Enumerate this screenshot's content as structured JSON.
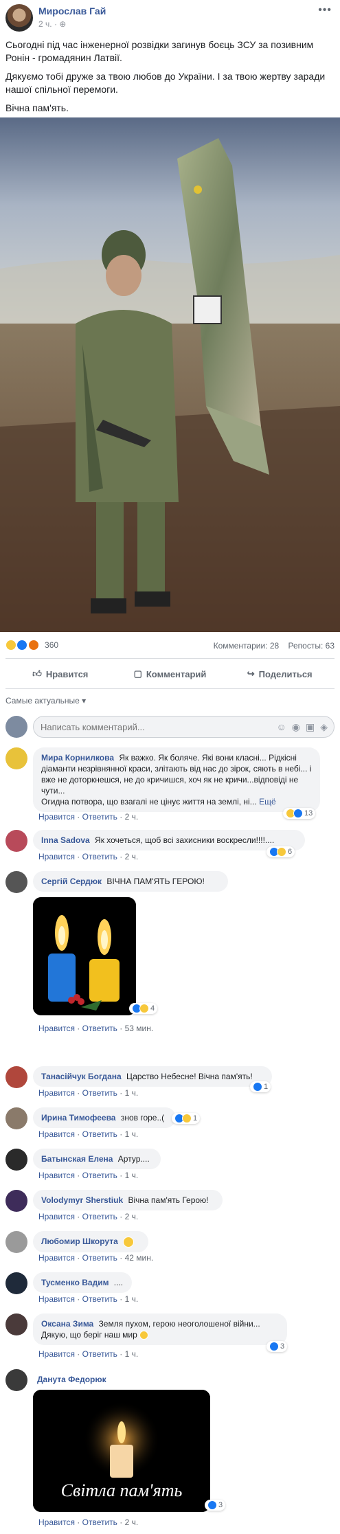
{
  "post": {
    "author": "Мирослав Гай",
    "time": "2 ч.",
    "paragraphs": [
      "Сьогодні під час інженерної розвідки загинув боєць ЗСУ за позивним Ронін - громадянин Латвії.",
      "Дякуємо тобі друже за твою любов до України. І за твою жертву заради нашої спільної перемоги.",
      "Вічна пам'ять."
    ],
    "reaction_count": "360",
    "comments_label": "Комментарии: 28",
    "shares_label": "Репосты: 63"
  },
  "actions": {
    "like": "Нравится",
    "comment": "Комментарий",
    "share": "Поделиться"
  },
  "sort_label": "Самые актуальные",
  "composer": {
    "placeholder": "Написать комментарий..."
  },
  "comment_actions": {
    "like": "Нравится",
    "reply": "Ответить"
  },
  "comments": [
    {
      "name": "Мира Корнилкова",
      "text": "Як важко. Як боляче. Які вони класні... Рідкісні діаманти незрівнянної краси, злітають від нас до зірок, сяють в небі... і вже не доторкнешся, не до кричишся, хоч як не кричи...відповіді не чути...",
      "text2": "Огидна потвора, що взагалі не цінує життя на землі, ні...",
      "more": "Ещё",
      "time": "2 ч.",
      "reactions": "13"
    },
    {
      "name": "Inna Sadova",
      "text": "Як хочеться, щоб всі захисники воскресли!!!!....",
      "time": "2 ч.",
      "reactions": "6"
    },
    {
      "name": "Сергій Сердюк",
      "text": "ВІЧНА ПАМ'ЯТЬ ГЕРОЮ!",
      "time": "53 мин.",
      "reactions": "4"
    },
    {
      "name": "Танасійчук Богдана",
      "text": "Царство Небесне! Вічна пам'ять!",
      "time": "1 ч.",
      "reactions": "1"
    },
    {
      "name": "Ирина Тимофеева",
      "text": "знов горе..(",
      "time": "1 ч.",
      "reactions": "1"
    },
    {
      "name": "Батынская Елена",
      "text": "Артур....",
      "time": "1 ч."
    },
    {
      "name": "Volodymyr Sherstiuk",
      "text": "Вічна пам'ять Герою!",
      "time": "2 ч."
    },
    {
      "name": "Любомир Шкорута",
      "text": "",
      "time": "42 мин."
    },
    {
      "name": "Тусменко Вадим",
      "text": "....",
      "time": "1 ч."
    },
    {
      "name": "Оксана Зима",
      "text": "Земля пухом, герою неоголошеної війни...",
      "text2": "Дякую, що беріг наш мир",
      "time": "1 ч.",
      "reactions": "3"
    },
    {
      "name": "Данута Федорюк",
      "text": "",
      "image_caption": "Світла пам'ять",
      "time": "2 ч.",
      "reactions": "3"
    }
  ]
}
